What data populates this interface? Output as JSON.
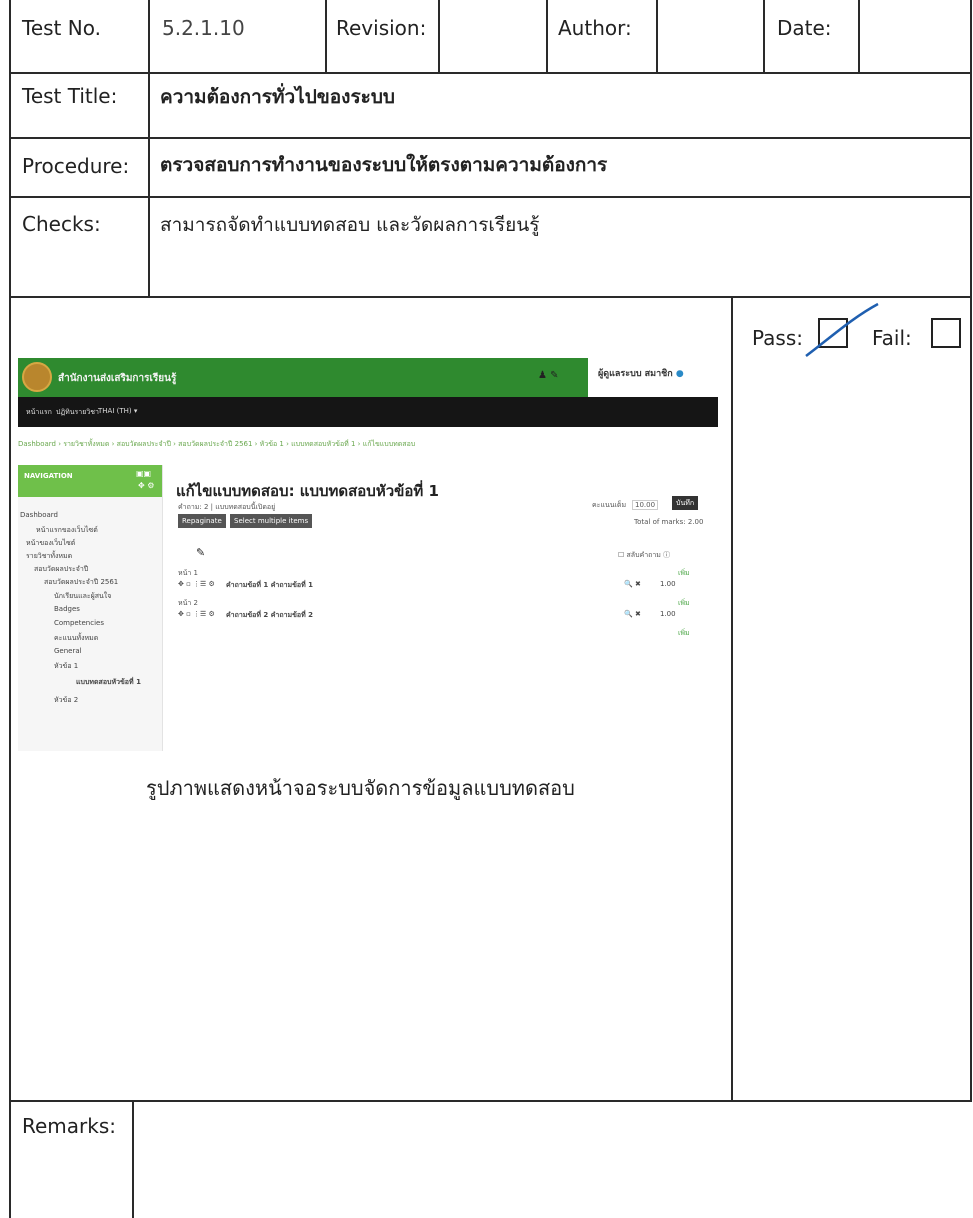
{
  "header": {
    "test_no_label": "Test No.",
    "test_no_value": "5.2.1.10",
    "revision_label": "Revision:",
    "revision_value": "",
    "author_label": "Author:",
    "author_value": "",
    "date_label": "Date:",
    "date_value": ""
  },
  "rows": {
    "title_label": "Test Title:",
    "title_value": "ความต้องการทั่วไปของระบบ",
    "procedure_label": "Procedure:",
    "procedure_value": "ตรวจสอบการทำงานของระบบให้ตรงตามความต้องการ",
    "checks_label": "Checks:",
    "checks_value": "สามารถจัดทำแบบทดสอบ และวัดผลการเรียนรู้",
    "remarks_label": "Remarks:",
    "remarks_value": ""
  },
  "result": {
    "pass_label": "Pass:",
    "fail_label": "Fail:",
    "pass_checked": true,
    "fail_checked": false
  },
  "caption": "รูปภาพแสดงหน้าจอระบบจัดการข้อมูลแบบทดสอบ",
  "screenshot": {
    "site_title": "สำนักงานส่งเสริมการเรียนรู้",
    "user_label": "ผู้ดูแลระบบ สมาชิก",
    "nav_items": [
      "หน้าแรก",
      "ปฏิทินรายวิชา",
      "THAI (TH) ▾"
    ],
    "breadcrumb": "Dashboard › รายวิชาทั้งหมด › สอบวัดผลประจำปี › สอบวัดผลประจำปี 2561 › หัวข้อ 1 › แบบทดสอบหัวข้อที่ 1 › แก้ไขแบบทดสอบ",
    "nav_block_title": "NAVIGATION",
    "sidebar_items": [
      "Dashboard",
      "หน้าแรกของเว็บไซต์",
      "หน้าของเว็บไซต์",
      "รายวิชาทั้งหมด",
      "สอบวัดผลประจำปี",
      "สอบวัดผลประจำปี 2561",
      "นักเรียนและผู้สนใจ",
      "Badges",
      "Competencies",
      "คะแนนทั้งหมด",
      "General",
      "หัวข้อ 1",
      "แบบทดสอบหัวข้อที่ 1",
      "หัวข้อ 2"
    ],
    "page_title": "แก้ไขแบบทดสอบ: แบบทดสอบหัวข้อที่ 1",
    "questions_info": "คำถาม: 2 | แบบทดสอบนี้เปิดอยู่",
    "max_grade_label": "คะแนนเต็ม",
    "max_grade_value": "10.00",
    "save_label": "บันทึก",
    "repaginate_label": "Repaginate",
    "select_multiple_label": "Select multiple items",
    "total_marks": "Total of marks: 2.00",
    "shuffle_label": "สลับคำถาม",
    "page1": "หน้า 1",
    "page2": "หน้า 2",
    "q1": "คำถามข้อที่ 1 คำถามข้อที่ 1",
    "q2": "คำถามข้อที่ 2 คำถามข้อที่ 2",
    "q1_mark": "1.00",
    "q2_mark": "1.00",
    "add_label": "เพิ่ม"
  }
}
